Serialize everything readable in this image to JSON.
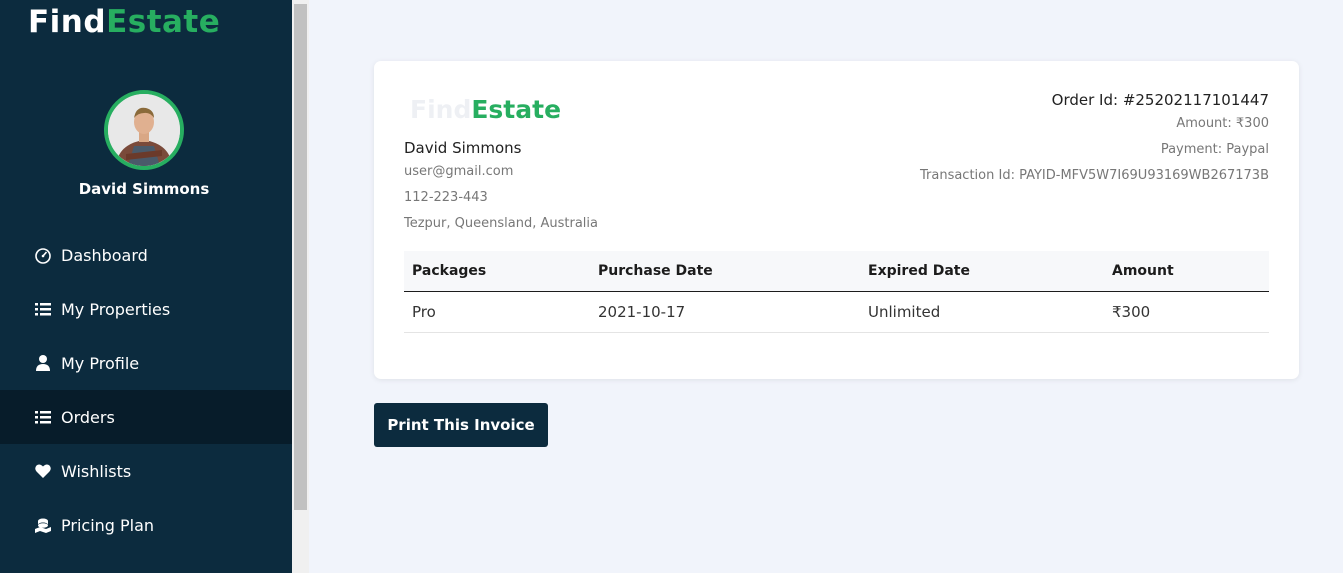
{
  "brand": {
    "part1": "Find",
    "part2": "Estate"
  },
  "user": {
    "name": "David Simmons"
  },
  "nav": {
    "items": [
      {
        "label": "Dashboard",
        "icon": "speedometer-icon"
      },
      {
        "label": "My Properties",
        "icon": "list-icon"
      },
      {
        "label": "My Profile",
        "icon": "user-icon"
      },
      {
        "label": "Orders",
        "icon": "list-icon",
        "active": true
      },
      {
        "label": "Wishlists",
        "icon": "heart-icon"
      },
      {
        "label": "Pricing Plan",
        "icon": "coins-icon"
      }
    ]
  },
  "invoice": {
    "logo": {
      "part1": "Find",
      "part2": "Estate"
    },
    "bill_to": {
      "name": "David Simmons",
      "email": "user@gmail.com",
      "phone": "112-223-443",
      "address": "Tezpur, Queensland, Australia"
    },
    "order_id": "Order Id: #25202117101447",
    "amount": "Amount: ₹300",
    "payment": "Payment: Paypal",
    "transaction": "Transaction Id: PAYID-MFV5W7I69U93169WB267173B",
    "table": {
      "headers": [
        "Packages",
        "Purchase Date",
        "Expired Date",
        "Amount"
      ],
      "rows": [
        [
          "Pro",
          "2021-10-17",
          "Unlimited",
          "₹300"
        ]
      ]
    }
  },
  "actions": {
    "print_label": "Print This Invoice"
  },
  "colors": {
    "sidebar": "#0c2b3e",
    "sidebar_active": "#071c2a",
    "accent": "#27ae60",
    "background": "#f1f4fb"
  }
}
